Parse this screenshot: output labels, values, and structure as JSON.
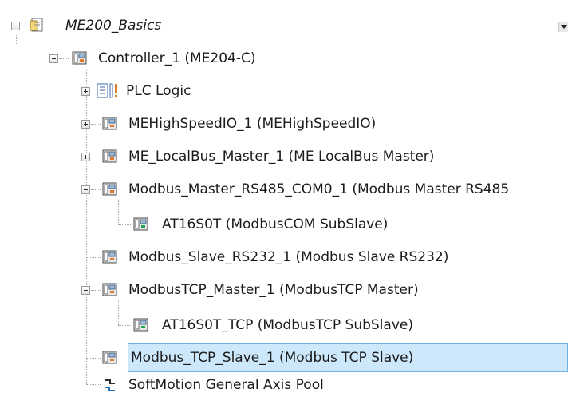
{
  "tree": {
    "items": [
      {
        "label": "ME200_Basics",
        "icon": "project-icon",
        "expanded": true
      },
      {
        "label": "Controller_1 (ME204-C)",
        "icon": "controller-icon",
        "expanded": true
      },
      {
        "label": "PLC Logic",
        "icon": "plc-logic-icon",
        "expanded": false
      },
      {
        "label": "MEHighSpeedIO_1 (MEHighSpeedIO)",
        "icon": "device-icon",
        "expanded": false
      },
      {
        "label": "ME_LocalBus_Master_1 (ME LocalBus Master)",
        "icon": "device-icon",
        "expanded": false
      },
      {
        "label": "Modbus_Master_RS485_COM0_1 (Modbus Master RS485",
        "icon": "device-icon",
        "expanded": true
      },
      {
        "label": "AT16S0T (ModbusCOM SubSlave)",
        "icon": "device-icon"
      },
      {
        "label": "Modbus_Slave_RS232_1 (Modbus Slave RS232)",
        "icon": "device-icon"
      },
      {
        "label": "ModbusTCP_Master_1 (ModbusTCP Master)",
        "icon": "device-icon",
        "expanded": true
      },
      {
        "label": "AT16S0T_TCP (ModbusTCP SubSlave)",
        "icon": "device-icon"
      },
      {
        "label": "Modbus_TCP_Slave_1 (Modbus TCP Slave)",
        "icon": "device-icon",
        "selected": true
      },
      {
        "label": "SoftMotion General Axis Pool",
        "icon": "axis-pool-icon"
      }
    ]
  },
  "colors": {
    "selection_background": "#cde8fb",
    "selection_border": "#6fb2e6",
    "tree_line": "#a8a8a8"
  }
}
